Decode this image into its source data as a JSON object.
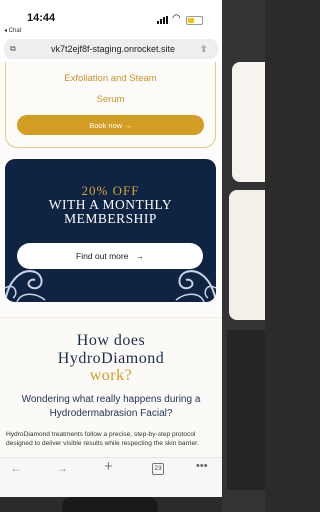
{
  "status": {
    "time": "14:44",
    "back_label": "◂ Chat"
  },
  "browser": {
    "url": "vk7t2ejf8f-staging.onrocket.site",
    "tabs_count": "23"
  },
  "product": {
    "name_line1": "Exfoliation and Steam",
    "name_line2": "Serum",
    "book_label": "Book now →"
  },
  "promo": {
    "line1": "20% OFF",
    "line2": "WITH A MONTHLY",
    "line3": "MEMBERSHIP",
    "button_label": "Find out more",
    "button_arrow": "→"
  },
  "section": {
    "heading_line1": "How does",
    "heading_line2": "HydroDiamond",
    "heading_line3": "work?",
    "sub_line1": "Wondering what really happens during a",
    "sub_line2": "Hydrodermabrasion Facial?",
    "body": "HydroDiamond treatments follow a precise, step-by-step protocol designed to deliver visible results while respecting the skin barrier."
  },
  "colors": {
    "accent": "#d39c23",
    "navy": "#0f2443",
    "heading": "#1e2e4a"
  },
  "icons": {
    "back": "chevron-left-icon",
    "forward": "chevron-right-icon",
    "new_tab": "plus-icon",
    "tabs": "tabs-icon",
    "more": "ellipsis-icon",
    "share": "share-icon",
    "tab_switch": "tab-icon"
  }
}
